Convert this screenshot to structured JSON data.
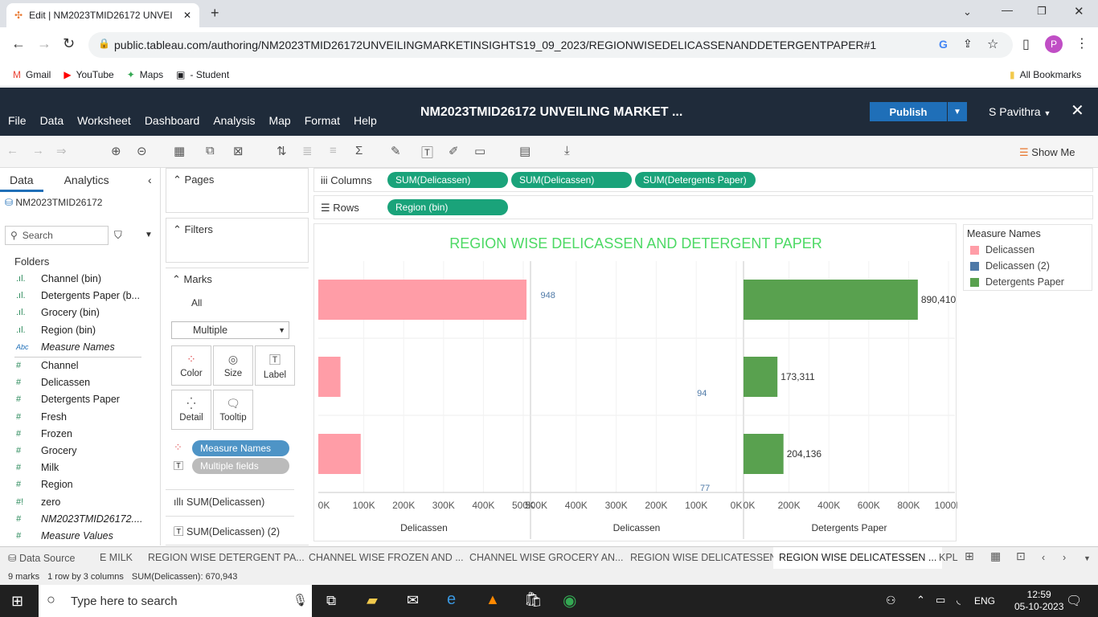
{
  "browser": {
    "tab_title": "Edit | NM2023TMID26172 UNVEI",
    "url": "public.tableau.com/authoring/NM2023TMID26172UNVEILINGMARKETINSIGHTS19_09_2023/REGIONWISEDELICASSENANDDETERGENTPAPER#1",
    "bookmarks": [
      "Gmail",
      "YouTube",
      "Maps",
      "- Student"
    ],
    "all_bookmarks": "All Bookmarks",
    "profile_initial": "P"
  },
  "app": {
    "menu": [
      "File",
      "Data",
      "Worksheet",
      "Dashboard",
      "Analysis",
      "Map",
      "Format",
      "Help"
    ],
    "workbook_title": "NM2023TMID26172 UNVEILING MARKET ...",
    "publish_label": "Publish",
    "user": "S Pavithra",
    "show_me": "Show Me"
  },
  "datapane": {
    "tabs": [
      "Data",
      "Analytics"
    ],
    "datasource": "NM2023TMID26172",
    "search_placeholder": "Search",
    "folders_label": "Folders",
    "fields": [
      {
        "name": "Channel (bin)",
        "kind": "bin"
      },
      {
        "name": "Detergents Paper (b...",
        "kind": "bin"
      },
      {
        "name": "Grocery (bin)",
        "kind": "bin"
      },
      {
        "name": "Region (bin)",
        "kind": "bin"
      },
      {
        "name": "Measure Names",
        "kind": "abc"
      },
      {
        "name": "Channel",
        "kind": "num"
      },
      {
        "name": "Delicassen",
        "kind": "num"
      },
      {
        "name": "Detergents Paper",
        "kind": "num"
      },
      {
        "name": "Fresh",
        "kind": "num"
      },
      {
        "name": "Frozen",
        "kind": "num"
      },
      {
        "name": "Grocery",
        "kind": "num"
      },
      {
        "name": "Milk",
        "kind": "num"
      },
      {
        "name": "Region",
        "kind": "num"
      },
      {
        "name": "zero",
        "kind": "calc"
      },
      {
        "name": "NM2023TMID26172....",
        "kind": "num-it"
      },
      {
        "name": "Measure Values",
        "kind": "num-it"
      }
    ]
  },
  "cards": {
    "pages": "Pages",
    "filters": "Filters",
    "marks": "Marks",
    "marks_all": "All",
    "mark_type": "Multiple",
    "buttons": [
      "Color",
      "Size",
      "Label",
      "Detail",
      "Tooltip"
    ],
    "mark_pills": [
      "Measure Names",
      "Multiple fields"
    ],
    "mark_sections": [
      "SUM(Delicassen)",
      "SUM(Delicassen) (2)"
    ]
  },
  "shelves": {
    "columns_label": "Columns",
    "rows_label": "Rows",
    "columns": [
      "SUM(Delicassen)",
      "SUM(Delicassen)",
      "SUM(Detergents Paper)"
    ],
    "rows": [
      "Region (bin)"
    ]
  },
  "colors": {
    "delicassen": "#ff9da7",
    "delicassen2": "#4e79a7",
    "detergents": "#59a14f",
    "title": "#4cd964",
    "label_blue": "#4e79a7"
  },
  "chart_data": {
    "type": "bar",
    "title": "REGION WISE DELICASSEN AND DETERGENT PAPER",
    "rows": 3,
    "panes": [
      {
        "axis_title": "Delicassen",
        "ticks": [
          "0K",
          "100K",
          "200K",
          "300K",
          "400K",
          "500K"
        ],
        "xlim": [
          0,
          520000
        ],
        "values": [
          512110,
          54506,
          104327
        ],
        "labels": [
          "",
          "",
          ""
        ]
      },
      {
        "axis_title": "Delicassen",
        "ticks": [
          "500K",
          "400K",
          "300K",
          "200K",
          "100K",
          "0K"
        ],
        "xlim": [
          0,
          570000
        ],
        "reversed": true,
        "values": [
          948,
          94,
          77
        ],
        "labels": [
          "948",
          "94",
          "77"
        ]
      },
      {
        "axis_title": "Detergents Paper",
        "ticks": [
          "0K",
          "200K",
          "400K",
          "600K",
          "800K",
          "1000K"
        ],
        "xlim": [
          0,
          1080000
        ],
        "values": [
          890410,
          173311,
          204136
        ],
        "labels": [
          "890,410",
          "173,311",
          "204,136"
        ]
      }
    ],
    "legend": {
      "title": "Measure Names",
      "items": [
        "Delicassen",
        "Delicassen (2)",
        "Detergents Paper"
      ]
    }
  },
  "sheets": [
    "E MILK",
    "REGION WISE DETERGENT PA...",
    "CHANNEL WISE FROZEN AND ...",
    "CHANNEL WISE GROCERY AN...",
    "REGION WISE DELICATESSEN",
    "REGION WISE DELICATESSEN ...",
    "KPL"
  ],
  "status": [
    "9 marks",
    "1 row by 3 columns",
    "SUM(Delicassen): 670,943"
  ],
  "taskbar": {
    "search_placeholder": "Type here to search",
    "lang": "ENG",
    "time": "12:59",
    "date": "05-10-2023"
  }
}
